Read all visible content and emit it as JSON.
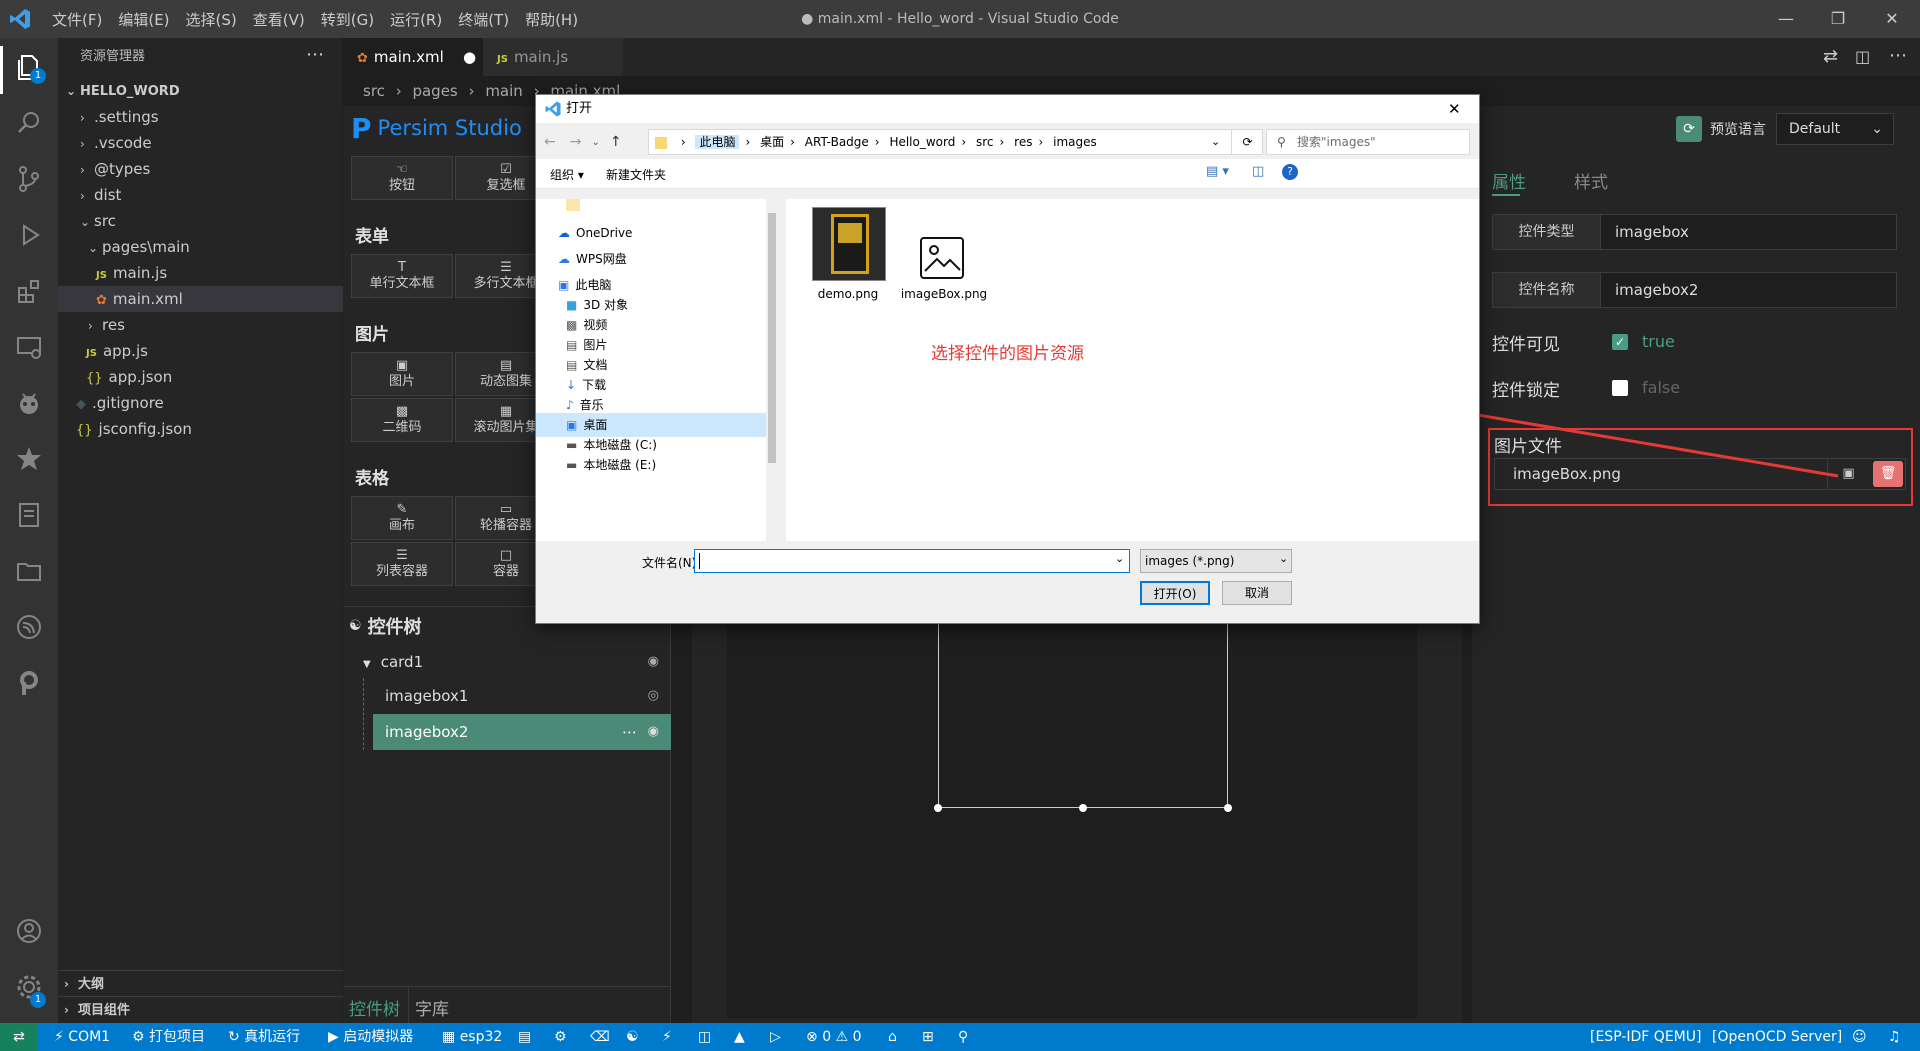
{
  "window": {
    "title": "● main.xml - Hello_word - Visual Studio Code",
    "menu": [
      "文件(F)",
      "编辑(E)",
      "选择(S)",
      "查看(V)",
      "转到(G)",
      "运行(R)",
      "终端(T)",
      "帮助(H)"
    ]
  },
  "explorer": {
    "header": "资源管理器",
    "project": "HELLO_WORD",
    "items": [
      {
        "label": ".settings",
        "kind": "folder"
      },
      {
        "label": ".vscode",
        "kind": "folder"
      },
      {
        "label": "@types",
        "kind": "folder"
      },
      {
        "label": "dist",
        "kind": "folder"
      },
      {
        "label": "src",
        "kind": "folder-open"
      },
      {
        "label": "pages\\main",
        "kind": "folder-open"
      },
      {
        "label": "main.js",
        "kind": "js"
      },
      {
        "label": "main.xml",
        "kind": "xml"
      },
      {
        "label": "res",
        "kind": "folder"
      },
      {
        "label": "app.js",
        "kind": "js"
      },
      {
        "label": "app.json",
        "kind": "json"
      },
      {
        "label": ".gitignore",
        "kind": "git"
      },
      {
        "label": "jsconfig.json",
        "kind": "json"
      }
    ],
    "outline": "大纲",
    "project_components": "项目组件"
  },
  "tabs": [
    {
      "label": "main.xml",
      "modified": true
    },
    {
      "label": "main.js"
    }
  ],
  "breadcrumb": [
    "src",
    "pages",
    "main",
    "main.xml"
  ],
  "persim": {
    "brand": "Persim Studio",
    "preview_lang_label": "预览语言",
    "preview_lang_value": "Default",
    "sections": {
      "row0": [
        "按钮",
        "复选框"
      ],
      "form_title": "表单",
      "form": [
        "单行文本框",
        "多行文本框"
      ],
      "image_title": "图片",
      "image": [
        "图片",
        "动态图集",
        "二维码",
        "滚动图片集"
      ],
      "table_title": "表格",
      "table": [
        "画布",
        "轮播容器",
        "列表容器",
        "容器"
      ]
    },
    "tree": {
      "title": "控件树",
      "nodes": [
        "card1",
        "imagebox1",
        "imagebox2"
      ],
      "bottom_tabs": [
        "控件树",
        "字库"
      ]
    },
    "props": {
      "tabs": [
        "属性",
        "样式"
      ],
      "type_label": "控件类型",
      "type_value": "imagebox",
      "name_label": "控件名称",
      "name_value": "imagebox2",
      "visible_label": "控件可见",
      "visible_value": "true",
      "locked_label": "控件锁定",
      "locked_value": "false",
      "image_file_label": "图片文件",
      "image_file_value": "imageBox.png"
    },
    "annotation": "选择控件的图片资源"
  },
  "dialog": {
    "title": "打开",
    "path": [
      "此电脑",
      "桌面",
      "ART-Badge",
      "Hello_word",
      "src",
      "res",
      "images"
    ],
    "search_placeholder": "搜索\"images\"",
    "organize": "组织",
    "new_folder": "新建文件夹",
    "nav": [
      {
        "label": "OneDrive"
      },
      {
        "label": "WPS网盘"
      },
      {
        "label": "此电脑"
      },
      {
        "label": "3D 对象"
      },
      {
        "label": "视频"
      },
      {
        "label": "图片"
      },
      {
        "label": "文档"
      },
      {
        "label": "下载"
      },
      {
        "label": "音乐"
      },
      {
        "label": "桌面",
        "selected": true
      },
      {
        "label": "本地磁盘 (C:)"
      },
      {
        "label": "本地磁盘 (E:)"
      }
    ],
    "files": [
      "demo.png",
      "imageBox.png"
    ],
    "filename_label": "文件名(N):",
    "filename_value": "",
    "filter": "images (*.png)",
    "open_button": "打开(O)",
    "cancel_button": "取消"
  },
  "statusbar": {
    "items": [
      "COM1",
      "打包项目",
      "真机运行",
      "启动模拟器",
      "esp32",
      "0",
      "0"
    ],
    "right": [
      "[ESP-IDF QEMU]",
      "[OpenOCD Server]"
    ]
  },
  "colors": {
    "accent": "#007acc",
    "selected_tree": "#37373d",
    "teal": "#4a8a76",
    "annotation_red": "#e53935"
  }
}
